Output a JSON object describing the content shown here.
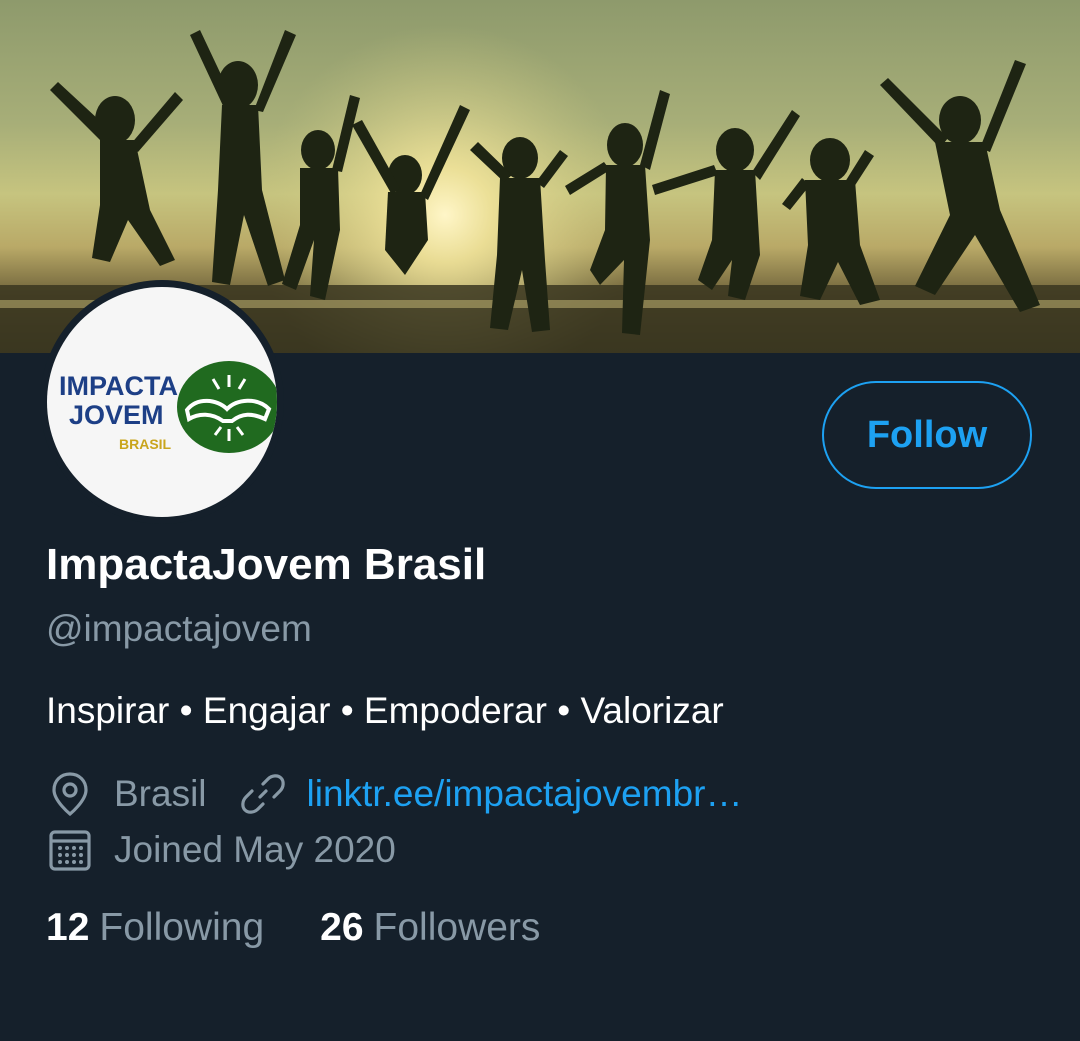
{
  "profile": {
    "display_name": "ImpactaJovem Brasil",
    "handle": "@impactajovem",
    "bio": "Inspirar • Engajar • Empoderar • Valorizar",
    "location": "Brasil",
    "website": "linktr.ee/impactajovembr…",
    "joined": "Joined May 2020"
  },
  "avatar_logo": {
    "line1": "IMPACTA",
    "line2": "JOVEM",
    "line3": "BRASIL"
  },
  "actions": {
    "follow_label": "Follow"
  },
  "stats": {
    "following_count": "12",
    "following_label": "Following",
    "followers_count": "26",
    "followers_label": "Followers"
  },
  "icons": {
    "location": "location-pin-icon",
    "website": "link-icon",
    "joined": "calendar-icon"
  },
  "colors": {
    "background": "#15202b",
    "accent": "#1da1f2",
    "secondary_text": "#8899a6"
  }
}
